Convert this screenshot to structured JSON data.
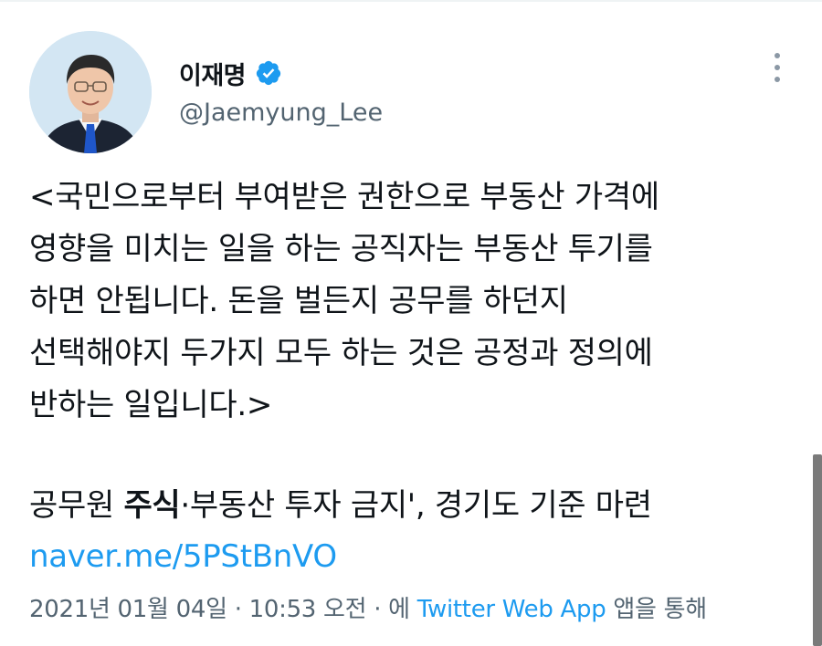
{
  "tweet": {
    "author": {
      "display_name": "이재명",
      "handle": "@Jaemyung_Lee",
      "verified": true
    },
    "body": "<국민으로부터 부여받은 권한으로 부동산 가격에\n영향을 미치는 일을 하는 공직자는 부동산 투기를\n하면 안됩니다. 돈을 벌든지 공무를 하던지\n선택해야지 두가지 모두 하는 것은 공정과 정의에\n반하는 일입니다.>",
    "link_title": {
      "before": "공무원 ",
      "bold": "주식",
      "after": "·부동산 투자 금지', 경기도 기준 마련"
    },
    "link_url": "naver.me/5PStBnVO",
    "meta": {
      "timestamp": "2021년 01월 04일 · 10:53 오전 · 에",
      "source": "Twitter Web App",
      "suffix": "앱을 통해"
    }
  },
  "icons": {
    "verified": "verified-badge-icon",
    "more": "more-vertical-icon"
  },
  "colors": {
    "link": "#1d9bf0",
    "secondary_text": "#536471",
    "primary_text": "#0f1419"
  }
}
